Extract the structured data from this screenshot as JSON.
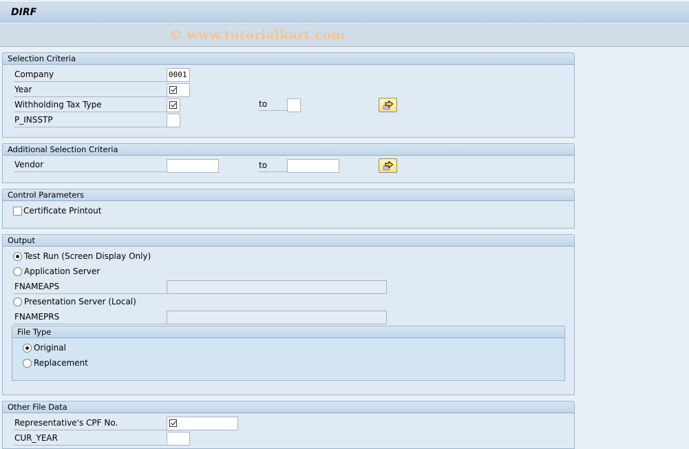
{
  "window": {
    "title": "DIRF"
  },
  "toolbar": {
    "watermark": "© www.tutorialkart.com"
  },
  "selection_criteria": {
    "header": "Selection Criteria",
    "company": {
      "label": "Company",
      "value": "0001"
    },
    "year": {
      "label": "Year",
      "required": true
    },
    "wht_type": {
      "label": "Withholding Tax Type",
      "required": true,
      "to_label": "to",
      "to_value": ""
    },
    "p_insstp": {
      "label": "P_INSSTP",
      "value": ""
    },
    "multiple_selection_icon": "multiple-selection-arrow-icon"
  },
  "additional_selection": {
    "header": "Additional Selection Criteria",
    "vendor": {
      "label": "Vendor",
      "from_value": "",
      "to_label": "to",
      "to_value": ""
    },
    "multiple_selection_icon": "multiple-selection-arrow-icon"
  },
  "control_parameters": {
    "header": "Control Parameters",
    "certificate_printout": {
      "label": "Certificate Printout",
      "checked": false
    }
  },
  "output": {
    "header": "Output",
    "options": [
      {
        "label": "Test Run (Screen Display Only)",
        "selected": true
      },
      {
        "label": "Application Server",
        "selected": false
      },
      {
        "label": "Presentation Server (Local)",
        "selected": false
      }
    ],
    "fnameaps": {
      "label": "FNAMEAPS",
      "value": ""
    },
    "fnameprs": {
      "label": "FNAMEPRS",
      "value": ""
    },
    "file_type": {
      "header": "File Type",
      "options": [
        {
          "label": "Original",
          "selected": true
        },
        {
          "label": "Replacement",
          "selected": false
        }
      ]
    }
  },
  "other_file_data": {
    "header": "Other File Data",
    "cpf": {
      "label": "Representative's CPF No.",
      "required": true
    },
    "cur_year": {
      "label": "CUR_YEAR",
      "value": ""
    }
  }
}
